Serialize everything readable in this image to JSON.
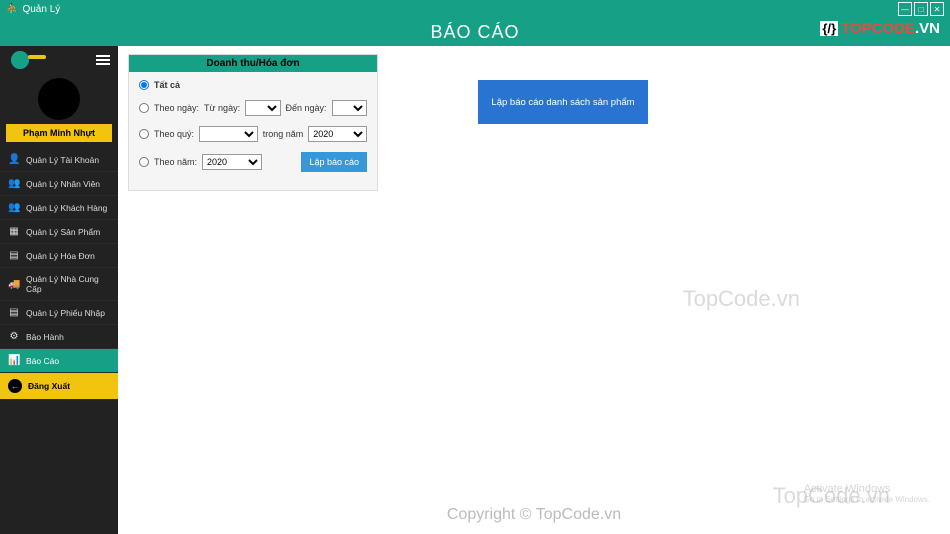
{
  "titlebar": {
    "app_name": "Quản Lý"
  },
  "header": {
    "title": "BÁO CÁO",
    "logo_text": "TOPCODE",
    "logo_suffix": ".VN"
  },
  "sidebar": {
    "user_name": "Phạm Minh Nhựt",
    "items": [
      {
        "label": "Quản Lý Tài Khoản",
        "icon": "👤"
      },
      {
        "label": "Quản Lý Nhân Viên",
        "icon": "👥"
      },
      {
        "label": "Quản Lý Khách Hàng",
        "icon": "👥"
      },
      {
        "label": "Quản Lý Sản Phẩm",
        "icon": "▦"
      },
      {
        "label": "Quản Lý Hóa Đơn",
        "icon": "▤"
      },
      {
        "label": "Quản Lý Nhà Cung Cấp",
        "icon": "🚚"
      },
      {
        "label": "Quản Lý Phiếu Nhập",
        "icon": "▤"
      },
      {
        "label": "Bảo Hành",
        "icon": "⚙"
      },
      {
        "label": "Báo Cáo",
        "icon": "📊"
      }
    ],
    "logout_label": "Đăng Xuất"
  },
  "panel": {
    "title": "Doanh thu/Hóa đơn",
    "opt_all": "Tất cả",
    "opt_by_day": "Theo ngày:",
    "from_label": "Từ ngày:",
    "to_label": "Đến ngày:",
    "opt_by_quarter": "Theo quý:",
    "in_year_label": "trong năm",
    "year_value": "2020",
    "opt_by_year": "Theo năm:",
    "year2_value": "2020",
    "btn_label": "Lập báo cáo"
  },
  "big_button": {
    "label": "Lập báo cáo danh sách sản phẩm"
  },
  "watermarks": {
    "w1": "TopCode.vn",
    "w2": "TopCode.vn",
    "w3": "Copyright © TopCode.vn",
    "activate_title": "Activate Windows",
    "activate_sub": "Go to Settings to activate Windows."
  }
}
